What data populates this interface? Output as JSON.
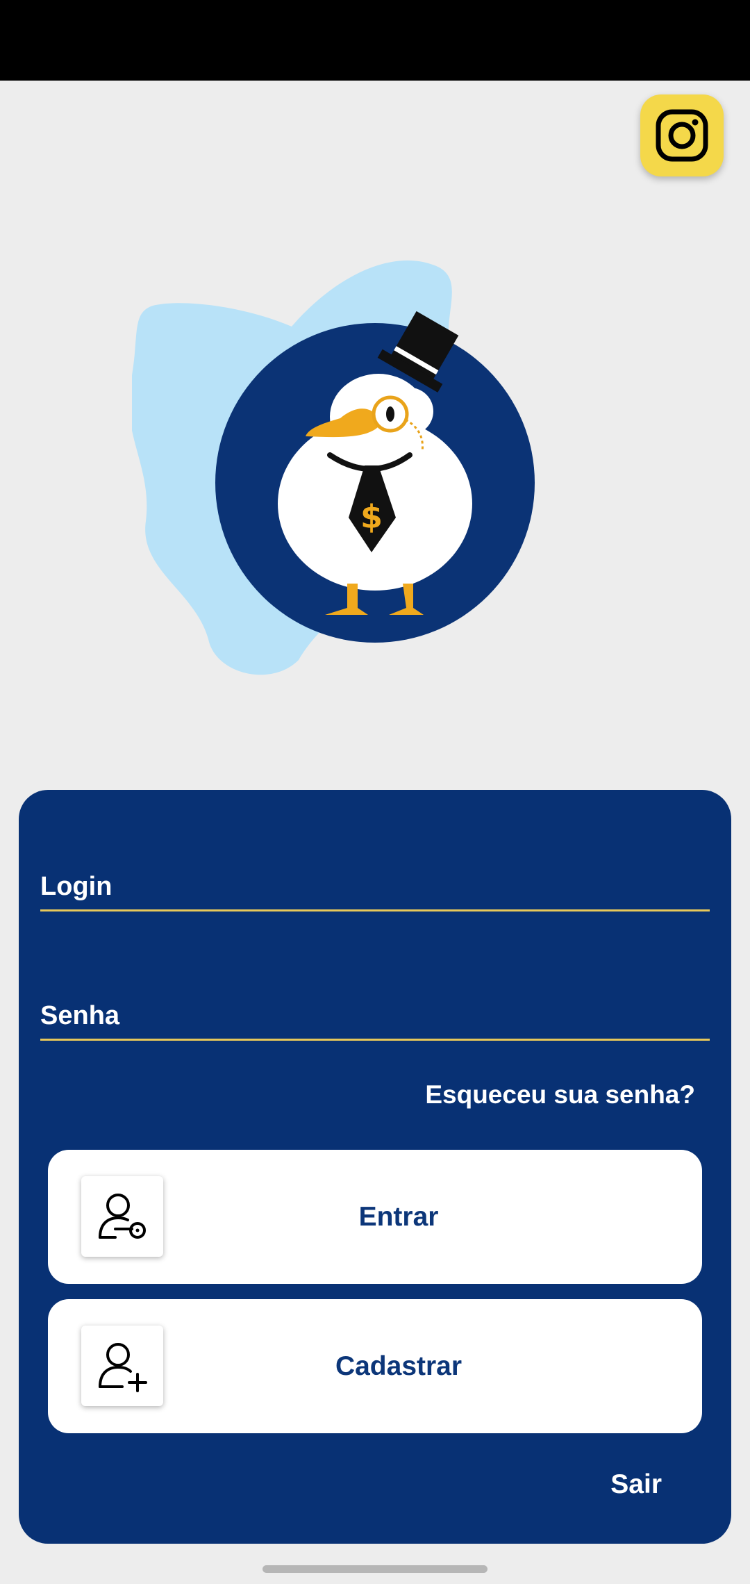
{
  "app": {
    "instagram_icon": "instagram-icon",
    "logo_icon": "duck-mascot-logo",
    "colors": {
      "background": "#ededed",
      "panel": "#083174",
      "accent_line": "#e7c85a",
      "instagram_button": "#f4d84a",
      "button_text": "#0c3679"
    }
  },
  "form": {
    "login_label": "Login",
    "login_value": "",
    "password_label": "Senha",
    "password_value": "",
    "forgot_password": "Esqueceu sua senha?"
  },
  "buttons": {
    "enter_label": "Entrar",
    "enter_icon": "user-key-icon",
    "register_label": "Cadastrar",
    "register_icon": "user-add-icon",
    "exit_label": "Sair"
  }
}
